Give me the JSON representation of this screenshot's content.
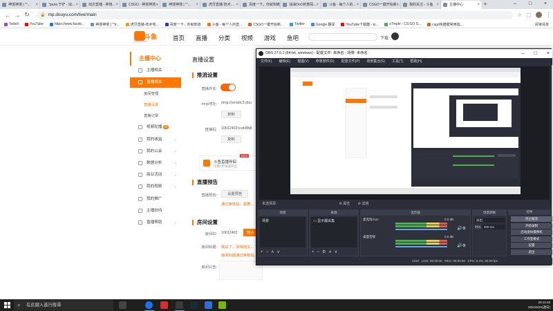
{
  "browser": {
    "tabs": [
      {
        "label": "神境神境 | \"\"...",
        "active": false
      },
      {
        "label": "\"рала 于铲 - 灿...",
        "active": false
      },
      {
        "label": "动次直播 - 神境...",
        "active": false
      },
      {
        "label": "CSGO - 神境神境...",
        "active": false
      },
      {
        "label": "神境神境 | \"\"...",
        "active": false
      },
      {
        "label": "虎牙直播·技术...",
        "active": false
      },
      {
        "label": "百度一下，你就知道",
        "active": false
      },
      {
        "label": "油油OnO的数码...",
        "active": false
      },
      {
        "label": "斗鱼 - 每个人的...",
        "active": false
      },
      {
        "label": "CSGO一键开始新...",
        "active": false
      },
      {
        "label": "我的关注 - 斗鱼",
        "active": false
      },
      {
        "label": "主播中心",
        "active": true
      }
    ],
    "new_tab_label": "+",
    "window_controls": [
      "–",
      "□",
      "×"
    ],
    "nav": {
      "back": "←",
      "forward": "→",
      "reload": "↻"
    },
    "url": "mp.douyu.com/live/main",
    "bookmarks": [
      {
        "label": "Twitch",
        "color": "#9146ff"
      },
      {
        "label": "YouTube",
        "color": "#ff0000"
      },
      {
        "label": "https://www.faceb...",
        "color": "#1877f2"
      },
      {
        "label": "神境神境 | \"\"tr...",
        "color": "#7a8da0"
      },
      {
        "label": "虎牙直播-技术宅...",
        "color": "#f4a300"
      },
      {
        "label": "百度一下，你就知道",
        "color": "#2932e1"
      },
      {
        "label": "斗鱼 - 每个人的直...",
        "color": "#f70"
      },
      {
        "label": "CSGO一键开始新...",
        "color": "#e06020"
      },
      {
        "label": "Twitter",
        "color": "#1da1f2"
      },
      {
        "label": "Google 翻译",
        "color": "#4285f4"
      },
      {
        "label": "YouTube下载器 - ki...",
        "color": "#ff0000"
      },
      {
        "label": "sTmple - CS:GO S...",
        "color": "#4caf50"
      },
      {
        "label": "csgo快捷键常用指...",
        "color": "#e06020"
      }
    ],
    "reading_list": "阅读清单"
  },
  "douyu": {
    "logo_text": "斗鱼",
    "logo_sub": "DOUYU.COM",
    "nav": [
      "首页",
      "直播",
      "分类",
      "视频",
      "游戏",
      "鱼吧"
    ],
    "user_label": "下载",
    "sidebar": {
      "title": "主播中心",
      "items": [
        {
          "label": "主播相关",
          "chev": "⌄"
        },
        {
          "label": "直播相关",
          "chev": "⌃",
          "active": true
        },
        {
          "label": "房间管理",
          "sub": true
        },
        {
          "label": "直播设置",
          "sub": true,
          "selected": true
        },
        {
          "label": "直播记录",
          "sub": true
        },
        {
          "label": "视频轮播",
          "badge": "新"
        },
        {
          "label": "我的收益",
          "chev": "⌄"
        },
        {
          "label": "我的公会",
          "chev": "⌄"
        },
        {
          "label": "数据分析",
          "chev": "⌄"
        },
        {
          "label": "商业活动",
          "chev": "⌄"
        },
        {
          "label": "我的视频",
          "chev": "⌄"
        },
        {
          "label": "我的推广",
          "chev": ""
        },
        {
          "label": "主播扶持",
          "chev": ""
        },
        {
          "label": "直播帮助",
          "chev": "⌄"
        }
      ]
    },
    "content": {
      "page_title": "直播设置",
      "push_section": "推流设置",
      "live_toggle_label": "直播开关:",
      "rtmp_label": "rtmp地址:",
      "rtmp_value": "rtmp://sendtc3.dou",
      "copy_btn": "复制",
      "code_label": "直播码:",
      "code_value": "10012402rLwk8N8",
      "copy_btn2": "复制",
      "promo_title": "斗鱼直播伴侣",
      "promo_sub": "仅需1步快速开启",
      "promo_new": "NEW",
      "preview_section": "直播预告",
      "preview_label": "直播预告:",
      "preview_btn": "设置预告",
      "preview_note": "通过审核后，需要...",
      "room_section": "房间设置",
      "room_id_label": "房间ID:",
      "room_id_value": "10012402",
      "room_id_btn": "填入",
      "room_title_label": "房间标题:",
      "room_title_value": "我设了，没有抱文...",
      "room_title_note": "房间标题通过审核后，",
      "announce_label": "房间公告:"
    }
  },
  "obs": {
    "title": "OBS 27.0.1 (64-bit, windows) - 配置文件: 未命名 - 场景: 未命名",
    "window_controls": [
      "–",
      "□",
      "×"
    ],
    "menu": [
      "文件(F)",
      "编辑(E)",
      "视图(V)",
      "停靠部件(D)",
      "配置文件(P)",
      "场景集合(S)",
      "工具(T)",
      "帮助(H)"
    ],
    "bottom_toolbar": [
      "未选择源",
      "⚙ 属性",
      "⚙ 滤镜"
    ],
    "docks": {
      "scenes": {
        "title": "场景",
        "items": [
          "场景"
        ]
      },
      "sources": {
        "title": "来源",
        "items": [
          "显示器采集"
        ]
      },
      "mixer": {
        "title": "混音器",
        "channels": [
          {
            "name": "麦克风/Aux",
            "db": "0.0 dB"
          },
          {
            "name": "桌面音频",
            "db": "0.0 dB"
          }
        ]
      },
      "transitions": {
        "title": "场景转换",
        "type": "淡出",
        "duration_label": "时长",
        "duration_value": "300 ms"
      },
      "controls": {
        "title": "控件",
        "buttons": [
          "停止推流",
          "开始录制",
          "启动虚拟摄像机",
          "工作室模式",
          "设置",
          "退出"
        ]
      }
    },
    "status": {
      "live": "LIVE: 00:00:00",
      "rec": "REC: 00:00:00",
      "cpu": "CPU: 0.4%, 60.00 fps",
      "bitrate": "1210"
    }
  },
  "taskbar": {
    "search_placeholder": "在此鍵入進行搜尋",
    "time": "20:12:16",
    "date": "2021/6/22(週日)",
    "apps": [
      {
        "name": "task-view",
        "color": "#444"
      },
      {
        "name": "chrome",
        "color": "#1a73e8"
      },
      {
        "name": "netease-music",
        "color": "#d32f2f"
      },
      {
        "name": "obs",
        "color": "#3a3a3a"
      },
      {
        "name": "steam",
        "color": "#1b2838"
      },
      {
        "name": "app-blue",
        "color": "#2f6fd8"
      },
      {
        "name": "nvidia",
        "color": "#76b900"
      }
    ]
  }
}
